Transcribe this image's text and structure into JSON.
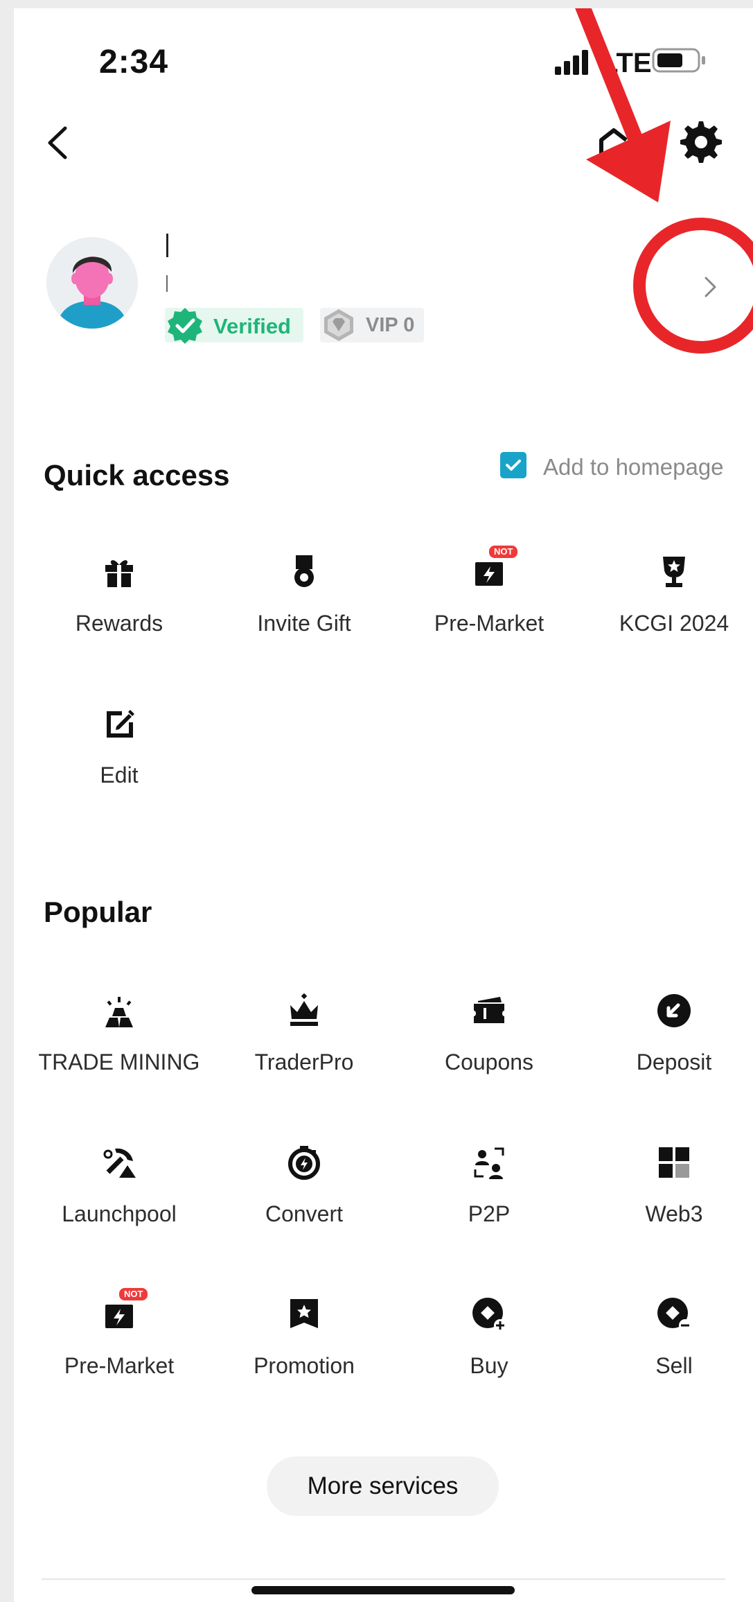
{
  "status_bar": {
    "time": "2:34",
    "carrier": "LTE"
  },
  "profile": {
    "verified_label": "Verified",
    "vip_label": "VIP 0"
  },
  "quick_access": {
    "title": "Quick access",
    "add_to_homepage": "Add to homepage",
    "add_to_homepage_checked": true,
    "items": [
      {
        "label": "Rewards",
        "icon": "gift-icon"
      },
      {
        "label": "Invite Gift",
        "icon": "medal-icon"
      },
      {
        "label": "Pre-Market",
        "icon": "premarket-icon",
        "badge": "NOT"
      },
      {
        "label": "KCGI 2024",
        "icon": "trophy-icon"
      },
      {
        "label": "Edit",
        "icon": "edit-icon"
      }
    ]
  },
  "popular": {
    "title": "Popular",
    "items": [
      {
        "label": "TRADE MINING",
        "icon": "mining-icon"
      },
      {
        "label": "TraderPro",
        "icon": "crown-icon"
      },
      {
        "label": "Coupons",
        "icon": "coupon-icon"
      },
      {
        "label": "Deposit",
        "icon": "deposit-icon"
      },
      {
        "label": "Launchpool",
        "icon": "pickaxe-icon"
      },
      {
        "label": "Convert",
        "icon": "convert-icon"
      },
      {
        "label": "P2P",
        "icon": "p2p-icon"
      },
      {
        "label": "Web3",
        "icon": "web3-icon"
      },
      {
        "label": "Pre-Market",
        "icon": "premarket-icon",
        "badge": "NOT"
      },
      {
        "label": "Promotion",
        "icon": "promotion-icon"
      },
      {
        "label": "Buy",
        "icon": "buy-icon"
      },
      {
        "label": "Sell",
        "icon": "sell-icon"
      }
    ]
  },
  "more_services_label": "More services",
  "colors": {
    "accent": "#1aa3c8",
    "verified_green": "#1fb57a",
    "annotation_red": "#e8262a",
    "badge_red": "#ef3a3a"
  }
}
